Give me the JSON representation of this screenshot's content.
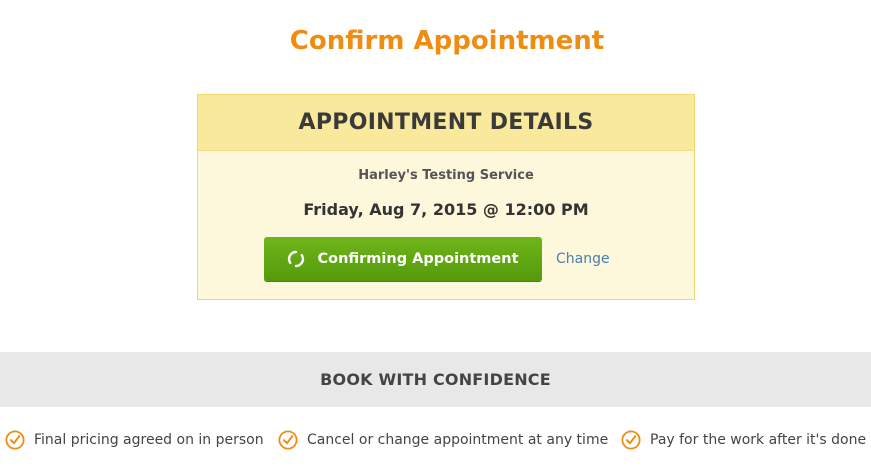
{
  "page": {
    "title": "Confirm Appointment"
  },
  "appointment": {
    "header": "APPOINTMENT DETAILS",
    "provider": "Harley's Testing Service",
    "datetime": "Friday, Aug 7, 2015 @ 12:00 PM",
    "confirm_button_label": "Confirming Appointment",
    "change_link_label": "Change"
  },
  "confidence": {
    "title": "BOOK WITH CONFIDENCE",
    "items": [
      {
        "label": "Final pricing agreed on in person"
      },
      {
        "label": "Cancel or change appointment at any time"
      },
      {
        "label": "Pay for the work after it's done"
      }
    ]
  },
  "colors": {
    "accent_orange": "#ef8c12",
    "button_green": "#62a814",
    "card_header_bg": "#f9e99c",
    "card_bg": "#fdf7dc",
    "link_blue": "#4a7fa8",
    "bar_gray": "#e8e8e8"
  },
  "icons": {
    "spinner": "loading-spinner-icon",
    "check": "check-circle-icon"
  }
}
